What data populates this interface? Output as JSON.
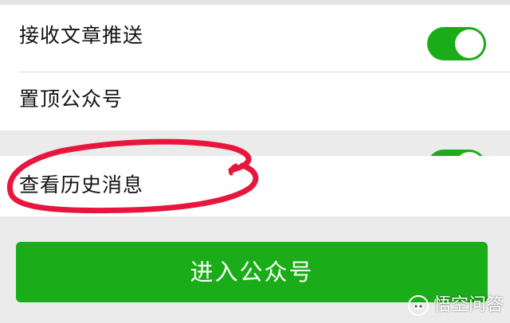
{
  "settings": {
    "receive_articles_label": "接收文章推送",
    "receive_articles_enabled": true,
    "pin_account_label": "置顶公众号",
    "pin_account_enabled": true
  },
  "history": {
    "label": "查看历史消息"
  },
  "enter_button": {
    "label": "进入公众号"
  },
  "watermark": {
    "text": "悟空问答",
    "logo_icon": "wukong-logo-icon"
  },
  "colors": {
    "accent": "#1aad19",
    "annotation_circle": "#e8163d",
    "page_background": "#ebebeb",
    "text": "#111111"
  }
}
